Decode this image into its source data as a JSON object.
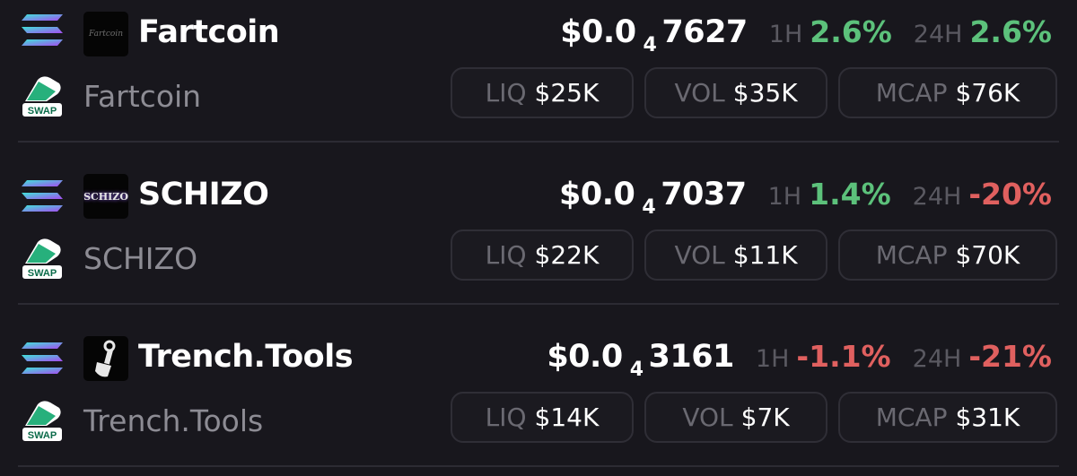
{
  "colors": {
    "background": "#18171d",
    "positive": "#5cc17b",
    "negative": "#e0605f",
    "muted_text": "#8d8c94"
  },
  "labels": {
    "h1": "1H",
    "h24": "24H",
    "liq": "LIQ",
    "vol": "VOL",
    "mcap": "MCAP",
    "swap": "SWAP"
  },
  "tokens": [
    {
      "name": "Fartcoin",
      "symbol": "Fartcoin",
      "logo_text": "Fartcoin",
      "price_prefix": "$0.0",
      "price_zeros": "4",
      "price_digits": "7627",
      "change_1h": "2.6%",
      "change_24h": "2.6%",
      "liq": "$25K",
      "vol": "$35K",
      "mcap": "$76K",
      "chain_icon": "solana-icon",
      "dex_icon": "swap-icon"
    },
    {
      "name": "SCHIZO",
      "symbol": "SCHIZO",
      "logo_text": "SCHIZO",
      "price_prefix": "$0.0",
      "price_zeros": "4",
      "price_digits": "7037",
      "change_1h": "1.4%",
      "change_24h": "-20%",
      "liq": "$22K",
      "vol": "$11K",
      "mcap": "$70K",
      "chain_icon": "solana-icon",
      "dex_icon": "swap-icon"
    },
    {
      "name": "Trench.Tools",
      "symbol": "Trench.Tools",
      "price_prefix": "$0.0",
      "price_zeros": "4",
      "price_digits": "3161",
      "change_1h": "-1.1%",
      "change_24h": "-21%",
      "liq": "$14K",
      "vol": "$7K",
      "mcap": "$31K",
      "chain_icon": "solana-icon",
      "dex_icon": "swap-icon"
    }
  ]
}
